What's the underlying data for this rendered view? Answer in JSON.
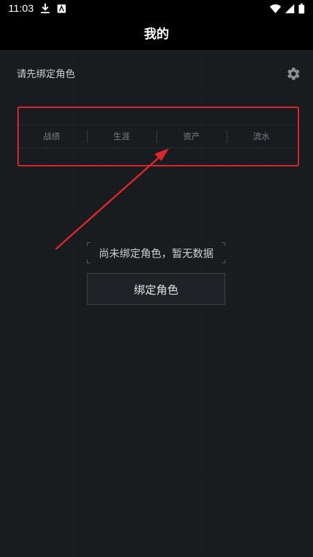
{
  "status_bar": {
    "time": "11:03",
    "icons": [
      "download-icon",
      "notification-app-icon",
      "wifi-icon",
      "cellular-signal-icon",
      "battery-icon"
    ]
  },
  "header": {
    "title": "我的"
  },
  "profile": {
    "bind_prompt": "请先绑定角色",
    "settings_icon": "gear-icon"
  },
  "stats_tabs": [
    "战绩",
    "生涯",
    "资产",
    "流水"
  ],
  "empty_state": {
    "message": "尚未绑定角色，暂无数据",
    "button_label": "绑定角色"
  },
  "colors": {
    "background": "#16191d",
    "bar": "#000000",
    "annotation": "#e0262a",
    "tab_text": "#7a7f86"
  }
}
